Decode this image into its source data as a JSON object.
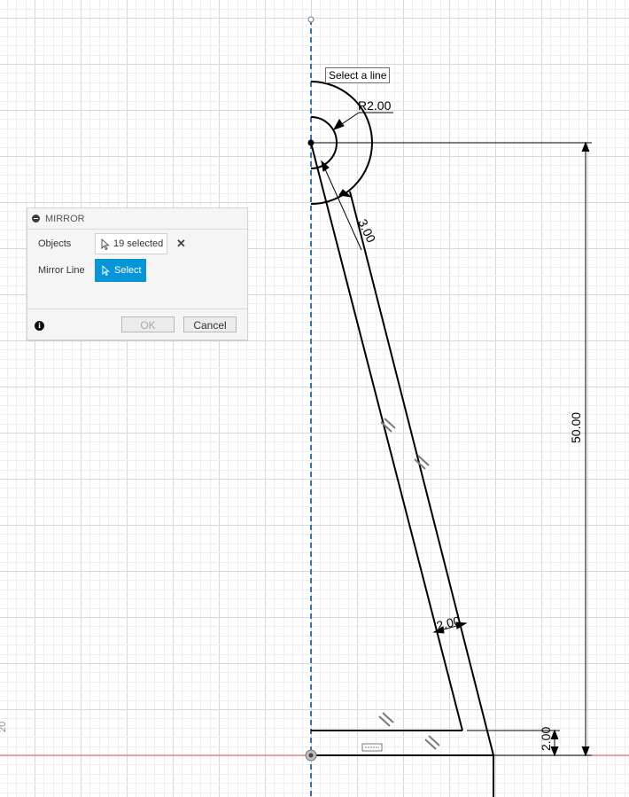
{
  "tooltip": {
    "text": "Select a line"
  },
  "dimensions": {
    "radius": "R2.00",
    "diag_top": "3.00",
    "vertical": "50.00",
    "width_mid": "2.00",
    "base_offset": "2.00"
  },
  "axis_label": "20",
  "mirror_panel": {
    "title": "MIRROR",
    "objects_label": "Objects",
    "objects_value": "19 selected",
    "mirror_line_label": "Mirror Line",
    "select_label": "Select",
    "ok_label": "OK",
    "cancel_label": "Cancel",
    "info_glyph": "i"
  },
  "colors": {
    "accent": "#0696d7",
    "axis_x": "#e8585a",
    "axis_y": "#3a6fb5",
    "grid_minor": "#eeeeee",
    "grid_major": "#d8d8d8"
  }
}
